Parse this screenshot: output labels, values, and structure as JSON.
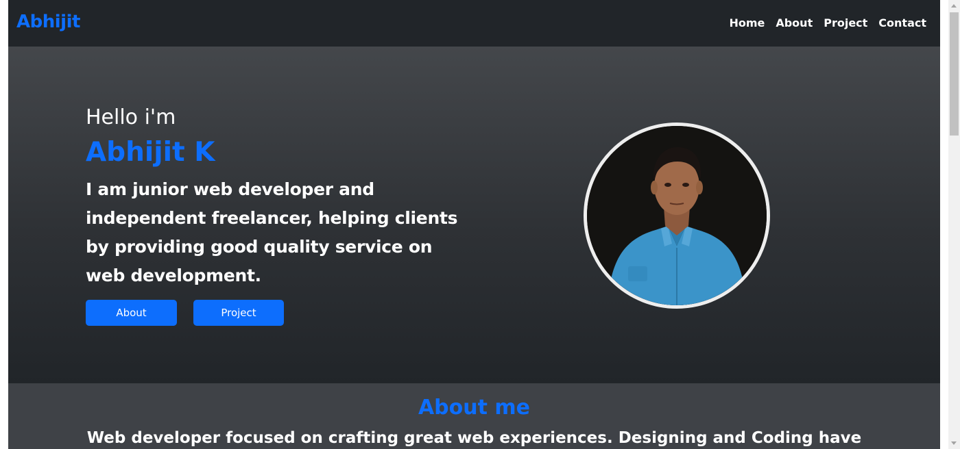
{
  "navbar": {
    "brand": "Abhijit",
    "links": [
      "Home",
      "About",
      "Project",
      "Contact"
    ]
  },
  "hero": {
    "greeting": "Hello i'm",
    "name": "Abhijit K",
    "description": "I am junior web developer and independent freelancer, helping clients by providing good quality service on web development.",
    "buttons": {
      "about": "About",
      "project": "Project"
    },
    "avatar_icon": "profile-photo"
  },
  "about": {
    "title": "About me",
    "text": "Web developer focused on crafting great web experiences. Designing and Coding have"
  },
  "colors": {
    "accent": "#0d6efd",
    "navbar_bg": "#212529",
    "about_bg": "#3f4247"
  }
}
